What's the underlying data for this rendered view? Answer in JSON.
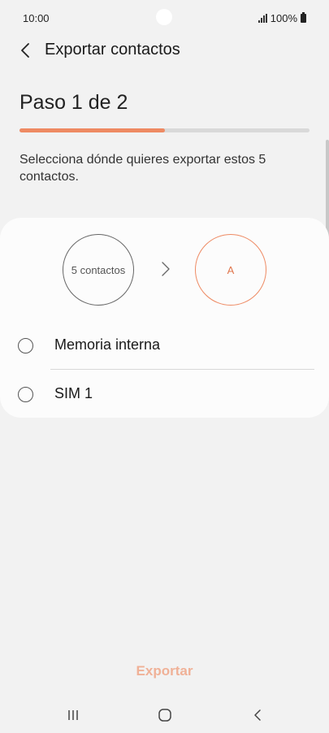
{
  "status_bar": {
    "time": "10:00",
    "battery": "100%",
    "icons": [
      "signal-icon",
      "battery-icon"
    ]
  },
  "header": {
    "title": "Exportar contactos",
    "back_icon": "chevron-left-icon"
  },
  "step": {
    "title": "Paso 1 de 2",
    "progress": 0.5,
    "description": "Selecciona dónde quieres exportar estos 5 contactos."
  },
  "card": {
    "source_label": "5 contactos",
    "target_label": "A",
    "arrow_icon": "chevron-right-icon",
    "options": [
      {
        "label": "Memoria interna",
        "selected": false
      },
      {
        "label": "SIM 1",
        "selected": false
      }
    ]
  },
  "footer": {
    "export_label": "Exportar"
  },
  "nav": {
    "icons": [
      "recent-apps-icon",
      "home-icon",
      "back-icon"
    ]
  },
  "colors": {
    "accent": "#ee8a63",
    "accent_disabled": "#f0b197",
    "background": "#f2f2f2",
    "card": "#fcfcfc"
  }
}
